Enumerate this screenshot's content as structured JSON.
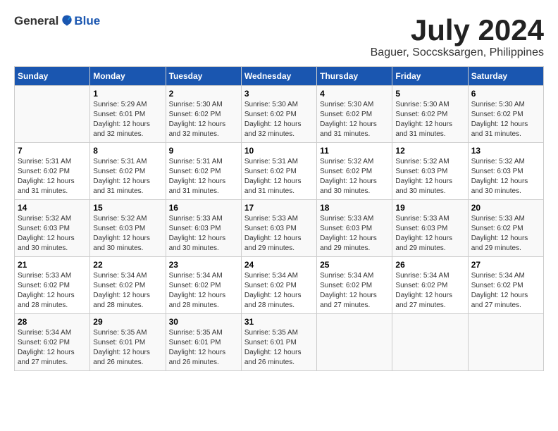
{
  "header": {
    "logo_general": "General",
    "logo_blue": "Blue",
    "month": "July 2024",
    "location": "Baguer, Soccsksargen, Philippines"
  },
  "weekdays": [
    "Sunday",
    "Monday",
    "Tuesday",
    "Wednesday",
    "Thursday",
    "Friday",
    "Saturday"
  ],
  "weeks": [
    [
      {
        "day": "",
        "sunrise": "",
        "sunset": "",
        "daylight": ""
      },
      {
        "day": "1",
        "sunrise": "Sunrise: 5:29 AM",
        "sunset": "Sunset: 6:01 PM",
        "daylight": "Daylight: 12 hours and 32 minutes."
      },
      {
        "day": "2",
        "sunrise": "Sunrise: 5:30 AM",
        "sunset": "Sunset: 6:02 PM",
        "daylight": "Daylight: 12 hours and 32 minutes."
      },
      {
        "day": "3",
        "sunrise": "Sunrise: 5:30 AM",
        "sunset": "Sunset: 6:02 PM",
        "daylight": "Daylight: 12 hours and 32 minutes."
      },
      {
        "day": "4",
        "sunrise": "Sunrise: 5:30 AM",
        "sunset": "Sunset: 6:02 PM",
        "daylight": "Daylight: 12 hours and 31 minutes."
      },
      {
        "day": "5",
        "sunrise": "Sunrise: 5:30 AM",
        "sunset": "Sunset: 6:02 PM",
        "daylight": "Daylight: 12 hours and 31 minutes."
      },
      {
        "day": "6",
        "sunrise": "Sunrise: 5:30 AM",
        "sunset": "Sunset: 6:02 PM",
        "daylight": "Daylight: 12 hours and 31 minutes."
      }
    ],
    [
      {
        "day": "7",
        "sunrise": "Sunrise: 5:31 AM",
        "sunset": "Sunset: 6:02 PM",
        "daylight": "Daylight: 12 hours and 31 minutes."
      },
      {
        "day": "8",
        "sunrise": "Sunrise: 5:31 AM",
        "sunset": "Sunset: 6:02 PM",
        "daylight": "Daylight: 12 hours and 31 minutes."
      },
      {
        "day": "9",
        "sunrise": "Sunrise: 5:31 AM",
        "sunset": "Sunset: 6:02 PM",
        "daylight": "Daylight: 12 hours and 31 minutes."
      },
      {
        "day": "10",
        "sunrise": "Sunrise: 5:31 AM",
        "sunset": "Sunset: 6:02 PM",
        "daylight": "Daylight: 12 hours and 31 minutes."
      },
      {
        "day": "11",
        "sunrise": "Sunrise: 5:32 AM",
        "sunset": "Sunset: 6:02 PM",
        "daylight": "Daylight: 12 hours and 30 minutes."
      },
      {
        "day": "12",
        "sunrise": "Sunrise: 5:32 AM",
        "sunset": "Sunset: 6:03 PM",
        "daylight": "Daylight: 12 hours and 30 minutes."
      },
      {
        "day": "13",
        "sunrise": "Sunrise: 5:32 AM",
        "sunset": "Sunset: 6:03 PM",
        "daylight": "Daylight: 12 hours and 30 minutes."
      }
    ],
    [
      {
        "day": "14",
        "sunrise": "Sunrise: 5:32 AM",
        "sunset": "Sunset: 6:03 PM",
        "daylight": "Daylight: 12 hours and 30 minutes."
      },
      {
        "day": "15",
        "sunrise": "Sunrise: 5:32 AM",
        "sunset": "Sunset: 6:03 PM",
        "daylight": "Daylight: 12 hours and 30 minutes."
      },
      {
        "day": "16",
        "sunrise": "Sunrise: 5:33 AM",
        "sunset": "Sunset: 6:03 PM",
        "daylight": "Daylight: 12 hours and 30 minutes."
      },
      {
        "day": "17",
        "sunrise": "Sunrise: 5:33 AM",
        "sunset": "Sunset: 6:03 PM",
        "daylight": "Daylight: 12 hours and 29 minutes."
      },
      {
        "day": "18",
        "sunrise": "Sunrise: 5:33 AM",
        "sunset": "Sunset: 6:03 PM",
        "daylight": "Daylight: 12 hours and 29 minutes."
      },
      {
        "day": "19",
        "sunrise": "Sunrise: 5:33 AM",
        "sunset": "Sunset: 6:03 PM",
        "daylight": "Daylight: 12 hours and 29 minutes."
      },
      {
        "day": "20",
        "sunrise": "Sunrise: 5:33 AM",
        "sunset": "Sunset: 6:02 PM",
        "daylight": "Daylight: 12 hours and 29 minutes."
      }
    ],
    [
      {
        "day": "21",
        "sunrise": "Sunrise: 5:33 AM",
        "sunset": "Sunset: 6:02 PM",
        "daylight": "Daylight: 12 hours and 28 minutes."
      },
      {
        "day": "22",
        "sunrise": "Sunrise: 5:34 AM",
        "sunset": "Sunset: 6:02 PM",
        "daylight": "Daylight: 12 hours and 28 minutes."
      },
      {
        "day": "23",
        "sunrise": "Sunrise: 5:34 AM",
        "sunset": "Sunset: 6:02 PM",
        "daylight": "Daylight: 12 hours and 28 minutes."
      },
      {
        "day": "24",
        "sunrise": "Sunrise: 5:34 AM",
        "sunset": "Sunset: 6:02 PM",
        "daylight": "Daylight: 12 hours and 28 minutes."
      },
      {
        "day": "25",
        "sunrise": "Sunrise: 5:34 AM",
        "sunset": "Sunset: 6:02 PM",
        "daylight": "Daylight: 12 hours and 27 minutes."
      },
      {
        "day": "26",
        "sunrise": "Sunrise: 5:34 AM",
        "sunset": "Sunset: 6:02 PM",
        "daylight": "Daylight: 12 hours and 27 minutes."
      },
      {
        "day": "27",
        "sunrise": "Sunrise: 5:34 AM",
        "sunset": "Sunset: 6:02 PM",
        "daylight": "Daylight: 12 hours and 27 minutes."
      }
    ],
    [
      {
        "day": "28",
        "sunrise": "Sunrise: 5:34 AM",
        "sunset": "Sunset: 6:02 PM",
        "daylight": "Daylight: 12 hours and 27 minutes."
      },
      {
        "day": "29",
        "sunrise": "Sunrise: 5:35 AM",
        "sunset": "Sunset: 6:01 PM",
        "daylight": "Daylight: 12 hours and 26 minutes."
      },
      {
        "day": "30",
        "sunrise": "Sunrise: 5:35 AM",
        "sunset": "Sunset: 6:01 PM",
        "daylight": "Daylight: 12 hours and 26 minutes."
      },
      {
        "day": "31",
        "sunrise": "Sunrise: 5:35 AM",
        "sunset": "Sunset: 6:01 PM",
        "daylight": "Daylight: 12 hours and 26 minutes."
      },
      {
        "day": "",
        "sunrise": "",
        "sunset": "",
        "daylight": ""
      },
      {
        "day": "",
        "sunrise": "",
        "sunset": "",
        "daylight": ""
      },
      {
        "day": "",
        "sunrise": "",
        "sunset": "",
        "daylight": ""
      }
    ]
  ]
}
